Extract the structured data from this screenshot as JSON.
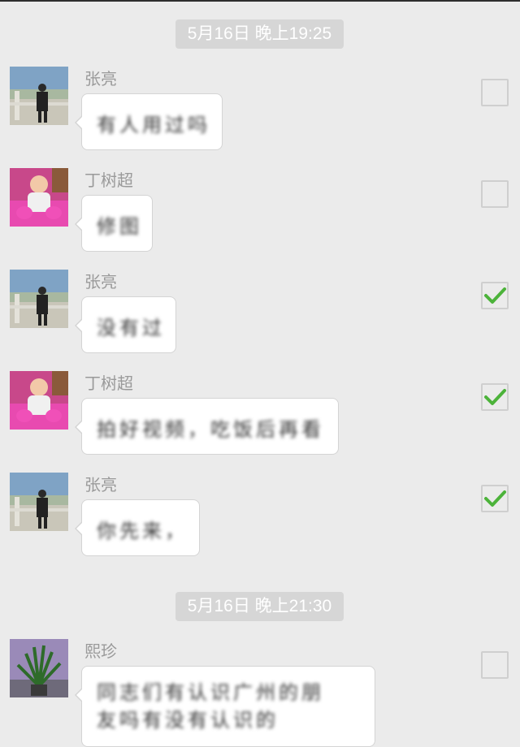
{
  "chat": {
    "groups": [
      {
        "timestamp": "5月16日 晚上19:25"
      },
      {
        "timestamp": "5月16日 晚上21:30"
      }
    ],
    "messages": [
      {
        "sender": "张亮",
        "text": "有人用过吗",
        "checked": false,
        "avatar": "landscape-avatar"
      },
      {
        "sender": "丁树超",
        "text": "修图",
        "checked": false,
        "avatar": "baby-avatar"
      },
      {
        "sender": "张亮",
        "text": "没有过",
        "checked": true,
        "avatar": "landscape-avatar"
      },
      {
        "sender": "丁树超",
        "text": "拍好视频，吃饭后再看",
        "checked": true,
        "avatar": "baby-avatar"
      },
      {
        "sender": "张亮",
        "text": "你先来，",
        "checked": true,
        "avatar": "landscape-avatar"
      },
      {
        "sender": "熙珍",
        "text": "同志们有认识广州的朋友吗有没有认识的",
        "checked": false,
        "avatar": "plant-avatar"
      }
    ]
  },
  "colors": {
    "check_green": "#4cb33a",
    "bubble_bg": "#ffffff",
    "background": "#ebebeb"
  }
}
